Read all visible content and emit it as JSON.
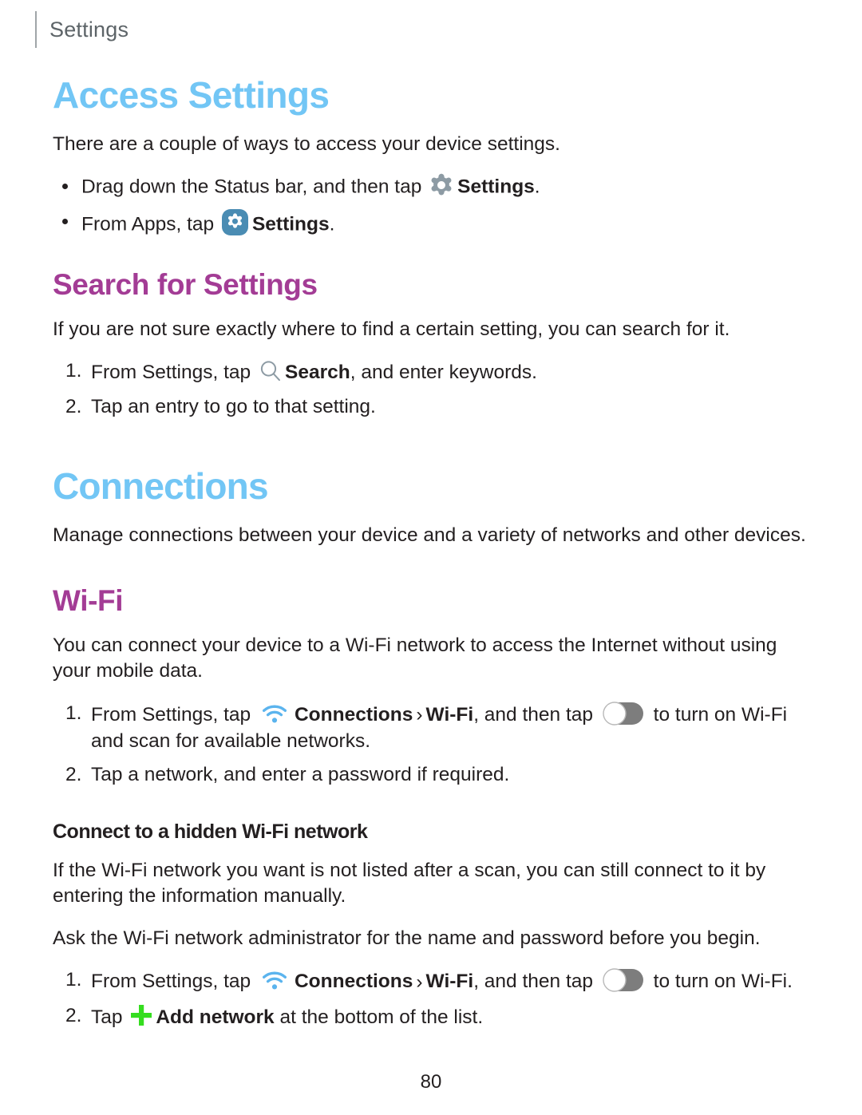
{
  "header": {
    "running_label": "Settings"
  },
  "colors": {
    "h1": "#72c6f5",
    "h2": "#a33c95",
    "h3": "#231f20",
    "body": "#231f20",
    "gear_plain": "#8d9ba4",
    "gear_badge_bg": "#4a8cb3",
    "gear_badge_glyph": "#ffffff",
    "search_icon": "#8d9ba4",
    "wifi_icon": "#5bb4ee",
    "toggle_track": "#7d7d7d",
    "toggle_knob": "#ffffff",
    "plus_icon": "#35dd1f",
    "header_rule": "#a0a5a8",
    "header_text": "#5d6468"
  },
  "sections": {
    "access_settings": {
      "title": "Access Settings",
      "intro": "There are a couple of ways to access your device settings.",
      "bullets": [
        {
          "pre": "Drag down the Status bar, and then tap ",
          "icon": "gear-icon",
          "bold": "Settings",
          "post": "."
        },
        {
          "pre": "From Apps, tap ",
          "icon": "settings-app-icon",
          "bold": "Settings",
          "post": "."
        }
      ]
    },
    "search_for_settings": {
      "title": "Search for Settings",
      "intro": "If you are not sure exactly where to find a certain setting, you can search for it.",
      "steps": [
        {
          "num": "1.",
          "pre": "From Settings, tap ",
          "icon": "search-icon",
          "bold": "Search",
          "post": ", and enter keywords."
        },
        {
          "num": "2.",
          "pre": "Tap an entry to go to that setting.",
          "icon": "",
          "bold": "",
          "post": ""
        }
      ]
    },
    "connections": {
      "title": "Connections",
      "intro": "Manage connections between your device and a variety of networks and other devices."
    },
    "wifi": {
      "title": "Wi-Fi",
      "intro": "You can connect your device to a Wi-Fi network to access the Internet without using your mobile data.",
      "steps": [
        {
          "num": "1.",
          "pre": "From Settings, tap ",
          "icon": "connections-wifi-icon",
          "bold": "Connections",
          "chevron": "›",
          "bold2": "Wi-Fi",
          "mid": ", and then tap ",
          "icon2": "toggle-off-icon",
          "post": " to turn on Wi-Fi and scan for available networks."
        },
        {
          "num": "2.",
          "pre": "Tap a network, and enter a password if required.",
          "icon": "",
          "bold": "",
          "post": ""
        }
      ]
    },
    "hidden_wifi": {
      "title": "Connect to a hidden Wi-Fi network",
      "intro": "If the Wi-Fi network you want is not listed after a scan, you can still connect to it by entering the information manually.",
      "note": "Ask the Wi-Fi network administrator for the name and password before you begin.",
      "steps": [
        {
          "num": "1.",
          "pre": "From Settings, tap ",
          "icon": "connections-wifi-icon",
          "bold": "Connections",
          "chevron": "›",
          "bold2": "Wi-Fi",
          "mid": ", and then tap ",
          "icon2": "toggle-off-icon",
          "post": " to turn on Wi-Fi."
        },
        {
          "num": "2.",
          "pre": "Tap ",
          "icon": "plus-icon",
          "bold": "Add network",
          "post": " at the bottom of the list."
        }
      ]
    }
  },
  "footer": {
    "page_number": "80"
  }
}
